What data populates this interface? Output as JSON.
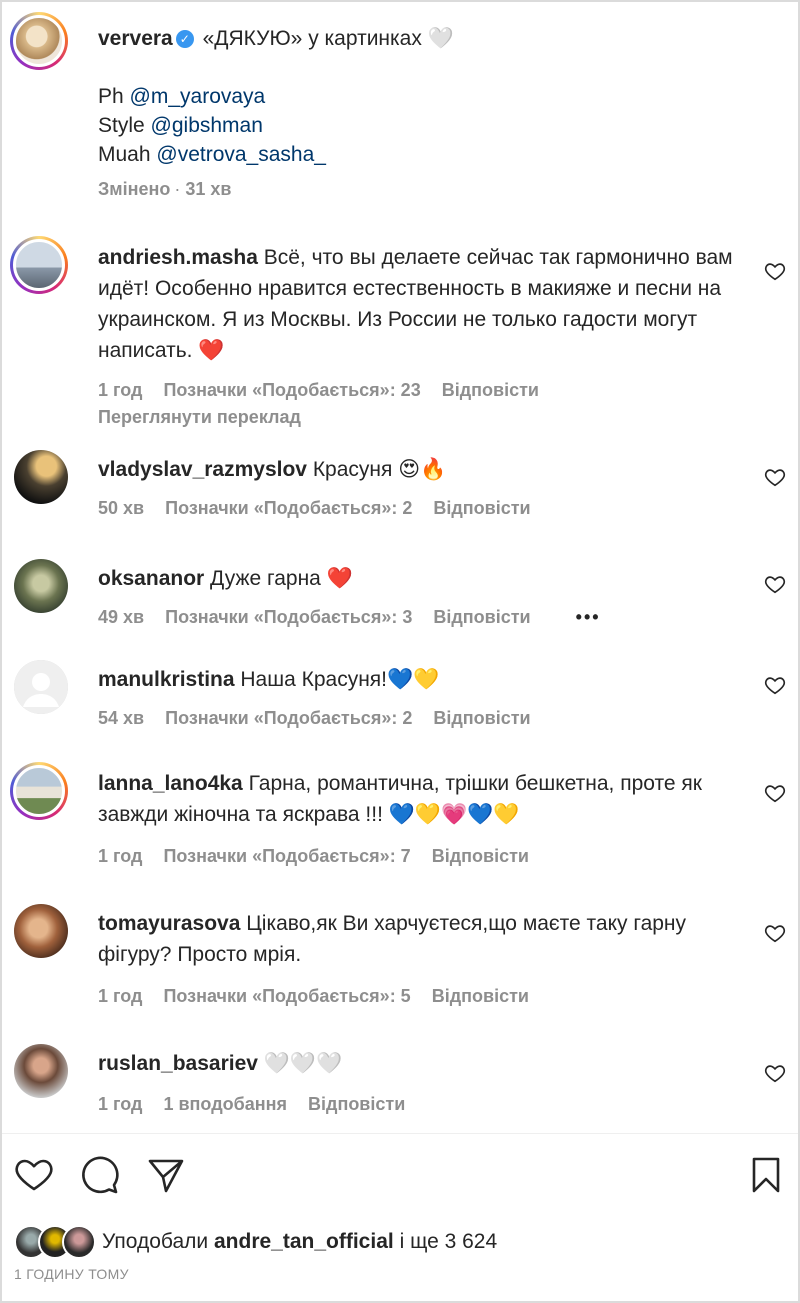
{
  "caption": {
    "username": "ververa",
    "text": "«ДЯКУЮ» у картинках",
    "lines": [
      {
        "prefix": "Ph",
        "mention": "@m_yarovaya"
      },
      {
        "prefix": "Style",
        "mention": "@gibshman"
      },
      {
        "prefix": "Muah",
        "mention": "@vetrova_sasha_"
      }
    ],
    "edited": "Змінено",
    "time": "31 хв"
  },
  "comments": [
    {
      "username": "andriesh.masha",
      "text": "Всё, что вы делаете сейчас так гармонично вам идёт! Особенно нравится естественность в макияже и песни на украинском. Я из Москвы. Из России не только гадости могут написать.",
      "emoji": "❤️",
      "time": "1 год",
      "likes": "Позначки «Подобається»: 23",
      "reply": "Відповісти",
      "translate": "Переглянути переклад"
    },
    {
      "username": "vladyslav_razmyslov",
      "text": "Красуня",
      "emoji": "😍🔥",
      "time": "50 хв",
      "likes": "Позначки «Подобається»: 2",
      "reply": "Відповісти"
    },
    {
      "username": "oksananor",
      "text": "Дуже гарна",
      "emoji": "❤️",
      "time": "49 хв",
      "likes": "Позначки «Подобається»: 3",
      "reply": "Відповісти",
      "more": "•••"
    },
    {
      "username": "manulkristina",
      "text": "Наша Красуня!",
      "emoji": "💙💛",
      "time": "54 хв",
      "likes": "Позначки «Подобається»: 2",
      "reply": "Відповісти"
    },
    {
      "username": "lanna_lano4ka",
      "text": "Гарна, романтична, трішки бешкетна, проте як завжди жіночна та яскрава !!!",
      "emoji": "💙💛💗💙💛",
      "time": "1 год",
      "likes": "Позначки «Подобається»: 7",
      "reply": "Відповісти"
    },
    {
      "username": "tomayurasova",
      "text": "Цікаво,як Ви харчуєтеся,що маєте таку гарну фігуру? Просто мрія.",
      "emoji": "",
      "time": "1 год",
      "likes": "Позначки «Подобається»: 5",
      "reply": "Відповісти"
    },
    {
      "username": "ruslan_basariev",
      "text": "",
      "emoji": "🤍🤍🤍",
      "time": "1 год",
      "likes": "1 вподобання",
      "reply": "Відповісти"
    }
  ],
  "likes_summary": {
    "prefix": "Уподобали",
    "user": "andre_tan_official",
    "suffix": "і ще 3 624"
  },
  "timestamp": "1 ГОДИНУ ТОМУ",
  "colors": {
    "mention": "#00376b",
    "meta": "#8e8e8e",
    "heart_red": "#ed4956",
    "verified": "#3897f0"
  }
}
